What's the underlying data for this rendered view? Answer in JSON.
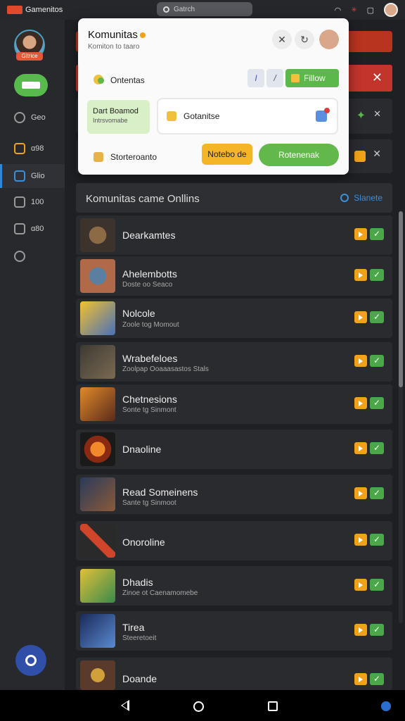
{
  "statusbar": {
    "app_title": "Gamenitos",
    "search_placeholder": "Gatrch"
  },
  "sidebar": {
    "avatar_badge": "Gitrice",
    "items": [
      {
        "label": "Geo",
        "icon": "controller-icon"
      },
      {
        "label": "ɑ98",
        "icon": "shield-icon"
      },
      {
        "label": "Glio",
        "icon": "book-icon"
      },
      {
        "label": "100",
        "icon": "edit-icon"
      },
      {
        "label": "ɑ80",
        "icon": "grid-icon"
      },
      {
        "label": "",
        "icon": "history-icon"
      }
    ]
  },
  "popup": {
    "title": "Komunitas",
    "subtitle": "Komiton to taaro",
    "row1_label": "Ontentas",
    "filter_label": "Fillow",
    "card_title": "Dart Boamod",
    "card_sub": "Intrsvomabe",
    "input_value": "Gotanitse",
    "row3_label": "Storteroanto",
    "yellow_btn": "Notebo de",
    "green_btn": "Rotenenak"
  },
  "section": {
    "title": "Komunitas came Onllins",
    "link": "Slanete"
  },
  "rows": [
    {
      "name": "Dearkamtes",
      "sub": ""
    },
    {
      "name": "Ahelembotts",
      "sub": "Doste oo Seaco"
    },
    {
      "name": "Nolcole",
      "sub": "Zoole tog Momout"
    },
    {
      "name": "Wrabefeloes",
      "sub": "Zoolpap Ooaaasastos Stals"
    },
    {
      "name": "Chetnesions",
      "sub": "Sonte tg Sinmont"
    },
    {
      "name": "Dnaoline",
      "sub": ""
    },
    {
      "name": "Read Someinens",
      "sub": "Sante tg Sinmoot"
    },
    {
      "name": "Onoroline",
      "sub": ""
    },
    {
      "name": "Dhadis",
      "sub": "Zinoe ot Caenamomebe"
    },
    {
      "name": "Tirea",
      "sub": "Steeretoeit"
    },
    {
      "name": "Doande",
      "sub": ""
    }
  ],
  "colors": {
    "accent_green": "#5cb84a",
    "accent_orange": "#f0a21b",
    "accent_red": "#c2342c",
    "link_blue": "#3b8fdc"
  }
}
